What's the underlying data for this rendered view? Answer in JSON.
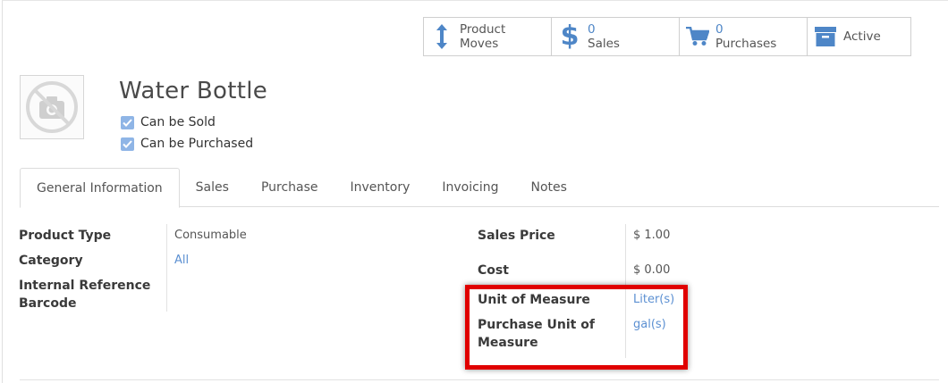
{
  "smart_buttons": [
    {
      "icon": "updown-arrow-icon",
      "line1": "Product",
      "line2": "Moves"
    },
    {
      "icon": "dollar-icon",
      "line1": "0",
      "line2": "Sales"
    },
    {
      "icon": "cart-icon",
      "line1": "0",
      "line2": "Purchases"
    },
    {
      "icon": "archive-icon",
      "line1": "Active"
    }
  ],
  "product": {
    "name": "Water Bottle",
    "can_be_sold": "Can be Sold",
    "can_be_purchased": "Can be Purchased"
  },
  "tabs": [
    "General Information",
    "Sales",
    "Purchase",
    "Inventory",
    "Invoicing",
    "Notes"
  ],
  "left_fields": {
    "product_type_label": "Product Type",
    "product_type_value": "Consumable",
    "category_label": "Category",
    "category_value": "All",
    "internal_ref_label": "Internal Reference",
    "barcode_label": "Barcode"
  },
  "right_fields": {
    "sales_price_label": "Sales Price",
    "sales_price_value": "$ 1.00",
    "cost_label": "Cost",
    "cost_value": "$ 0.00",
    "uom_label": "Unit of Measure",
    "uom_value": "Liter(s)",
    "purchase_uom_label_1": "Purchase Unit of",
    "purchase_uom_label_2": "Measure",
    "purchase_uom_value": "gal(s)"
  },
  "colors": {
    "accent": "#5c90d2",
    "icon": "#4e86c7",
    "highlight": "#e00000",
    "checkbox": "#8fb5e6"
  }
}
